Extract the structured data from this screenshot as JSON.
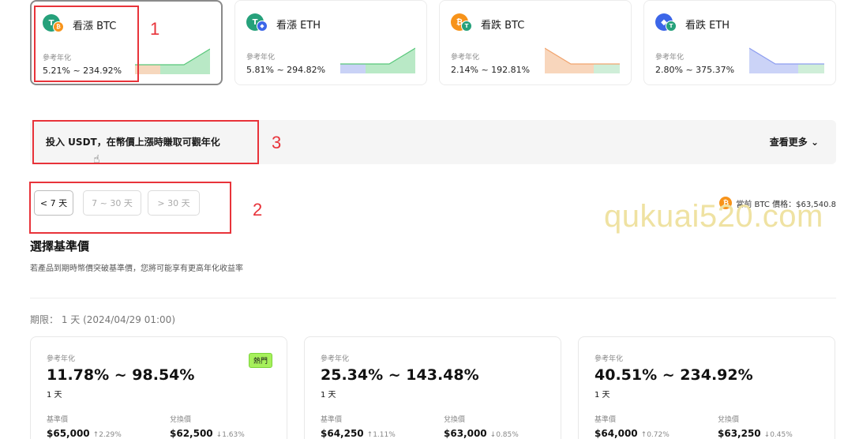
{
  "products": [
    {
      "coin_main": "T",
      "coin_sub": "₿",
      "title": "看漲 BTC",
      "ref_label": "參考年化",
      "range": "5.21% ~ 234.92%",
      "trend": "up",
      "selected": true
    },
    {
      "coin_main": "T",
      "coin_sub": "◆",
      "title": "看漲 ETH",
      "ref_label": "參考年化",
      "range": "5.81% ~ 294.82%",
      "trend": "up",
      "selected": false
    },
    {
      "coin_main": "₿",
      "coin_sub": "T",
      "title": "看跌 BTC",
      "ref_label": "參考年化",
      "range": "2.14% ~ 192.81%",
      "trend": "down",
      "selected": false
    },
    {
      "coin_main": "◆",
      "coin_sub": "T",
      "title": "看跌 ETH",
      "ref_label": "參考年化",
      "range": "2.80% ~ 375.37%",
      "trend": "down",
      "selected": false
    }
  ],
  "annotations": [
    "1",
    "2",
    "3"
  ],
  "banner": {
    "text": "投入 USDT，在幣價上漲時賺取可觀年化",
    "more": "查看更多"
  },
  "durations": [
    "< 7 天",
    "7 ~ 30 天",
    "> 30 天"
  ],
  "current_price": {
    "coin": "₿",
    "label": "當前 BTC 價格：$63,540.8"
  },
  "watermark": "qukuai520.com",
  "section": {
    "title": "選擇基準價",
    "subtitle": "若產品到期時幣價突破基準價，您將可能享有更高年化收益率"
  },
  "period": "期限： 1 天 (2024/04/29 01:00)",
  "options": [
    {
      "label": "參考年化",
      "range": "11.78% ~ 98.54%",
      "days": "1 天",
      "badge": "熱門",
      "base_label": "基準價",
      "base": "$65,000",
      "base_chg": "↑2.29%",
      "conv_label": "兌換價",
      "conv": "$62,500",
      "conv_chg": "↓1.63%"
    },
    {
      "label": "參考年化",
      "range": "25.34% ~ 143.48%",
      "days": "1 天",
      "badge": "",
      "base_label": "基準價",
      "base": "$64,250",
      "base_chg": "↑1.11%",
      "conv_label": "兌換價",
      "conv": "$63,000",
      "conv_chg": "↓0.85%"
    },
    {
      "label": "參考年化",
      "range": "40.51% ~ 234.92%",
      "days": "1 天",
      "badge": "",
      "base_label": "基準價",
      "base": "$64,000",
      "base_chg": "↑0.72%",
      "conv_label": "兌換價",
      "conv": "$63,250",
      "conv_chg": "↓0.45%"
    }
  ],
  "colors": {
    "up_fill": "#58c77a",
    "up_base": "#f2c6a0",
    "down_fill": "#f1b88e",
    "down_alt": "#8e9ef0",
    "highlight_red": "#e8333a",
    "badge_green": "#a6f05b"
  }
}
